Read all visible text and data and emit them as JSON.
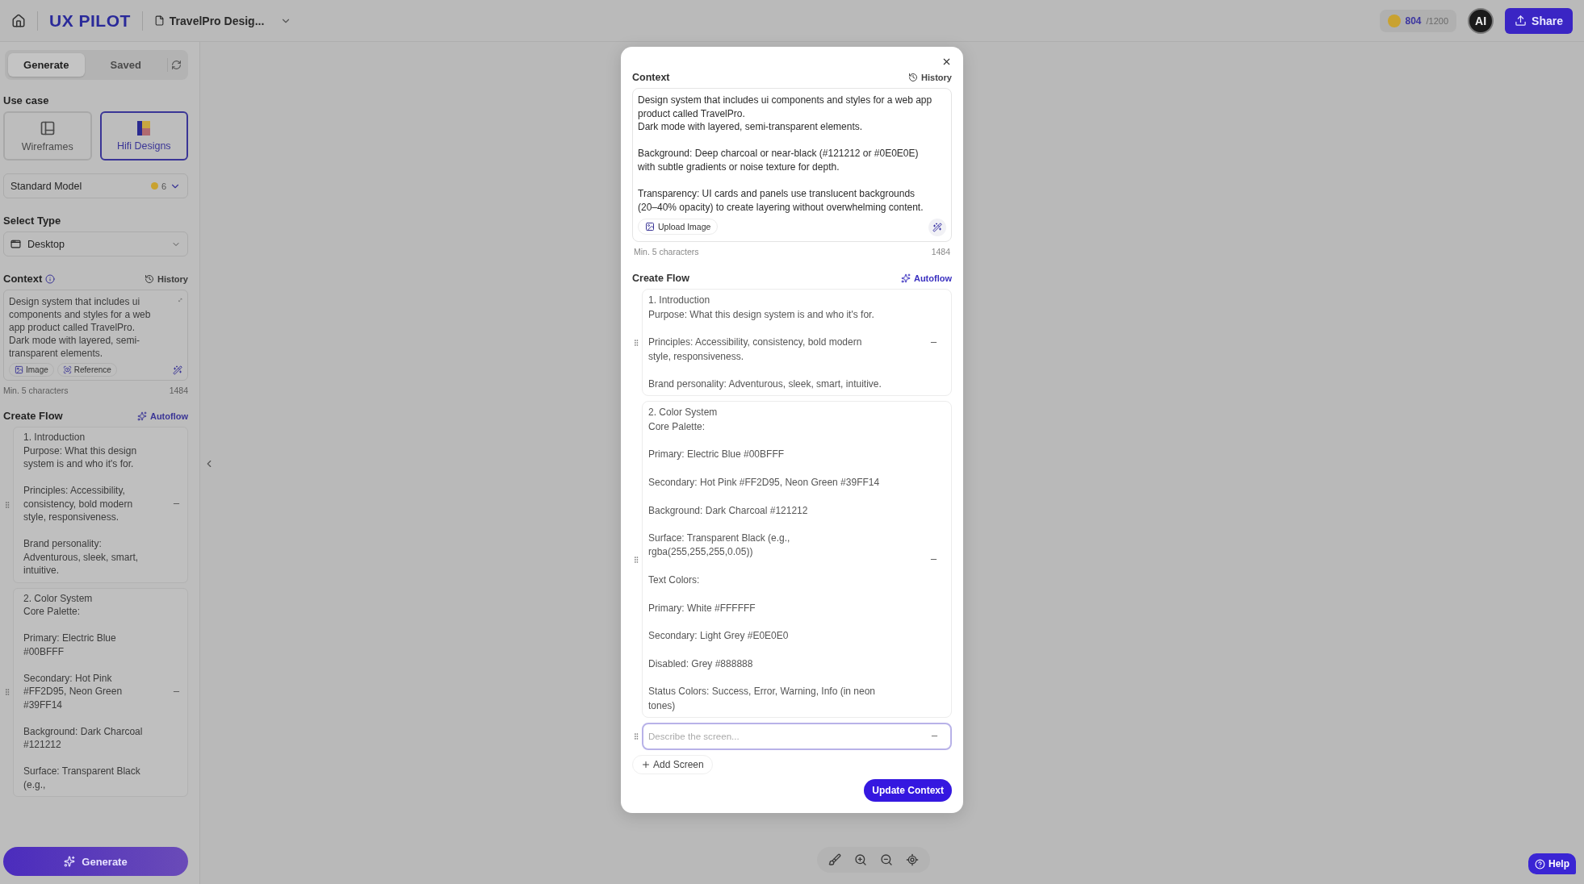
{
  "top_bar": {
    "logo": "UX PILOT",
    "project_name": "TravelPro Desig...",
    "credits_used": "804",
    "credits_total": "/1200",
    "avatar": "AI",
    "share": "Share"
  },
  "sidebar": {
    "tabs": [
      {
        "label": "Generate",
        "selected": true
      },
      {
        "label": "Saved",
        "selected": false
      }
    ],
    "use_case": {
      "label": "Use case",
      "options": [
        {
          "label": "Wireframes",
          "kind": "wireframe",
          "selected": false
        },
        {
          "label": "Hifi Designs",
          "kind": "hifi",
          "selected": true
        }
      ]
    },
    "model": {
      "label": "Standard Model",
      "cost": "6"
    },
    "select_type": {
      "label": "Select Type",
      "value": "Desktop"
    },
    "context": {
      "label": "Context",
      "history": "History",
      "text": "Design system that includes ui components and styles for a web app product called TravelPro.\nDark mode with layered, semi-transparent elements.",
      "attachments": [
        {
          "label": "Image",
          "kind": "image"
        },
        {
          "label": "Reference",
          "kind": "reference"
        }
      ],
      "hint": "Min. 5 characters",
      "count": "1484"
    },
    "create_flow": {
      "label": "Create Flow",
      "autoflow": "Autoflow",
      "screens": [
        "1. Introduction\nPurpose: What this design system is and who it's for.\n\nPrinciples: Accessibility, consistency, bold modern style, responsiveness.\n\nBrand personality: Adventurous, sleek, smart, intuitive.",
        "2. Color System\nCore Palette:\n\nPrimary: Electric Blue #00BFFF\n\nSecondary: Hot Pink #FF2D95, Neon Green #39FF14\n\nBackground: Dark Charcoal #121212\n\nSurface: Transparent Black (e.g.,"
      ]
    },
    "generate": "Generate"
  },
  "modal": {
    "context": {
      "label": "Context",
      "history": "History",
      "text": "Design system that includes ui components and styles for a web app product called TravelPro.\nDark mode with layered, semi-transparent elements.\n\nBackground: Deep charcoal or near-black (#121212 or #0E0E0E) with subtle gradients or noise texture for depth.\n\nTransparency: UI cards and panels use translucent backgrounds (20–40% opacity) to create layering without overwhelming content.",
      "upload": "Upload Image",
      "hint": "Min. 5 characters",
      "count": "1484"
    },
    "create_flow": {
      "label": "Create Flow",
      "autoflow": "Autoflow",
      "screens": [
        "1. Introduction\nPurpose: What this design system is and who it's for.\n\nPrinciples: Accessibility, consistency, bold modern style, responsiveness.\n\nBrand personality: Adventurous, sleek, smart, intuitive.",
        "2. Color System\nCore Palette:\n\nPrimary: Electric Blue #00BFFF\n\nSecondary: Hot Pink #FF2D95, Neon Green #39FF14\n\nBackground: Dark Charcoal #121212\n\nSurface: Transparent Black (e.g., rgba(255,255,255,0.05))\n\nText Colors:\n\nPrimary: White #FFFFFF\n\nSecondary: Light Grey #E0E0E0\n\nDisabled: Grey #888888\n\nStatus Colors: Success, Error, Warning, Info (in neon tones)"
      ],
      "new_screen": {
        "placeholder": "Describe the screen..."
      }
    },
    "add_screen": "Add Screen",
    "update": "Update Context"
  },
  "help": "Help"
}
